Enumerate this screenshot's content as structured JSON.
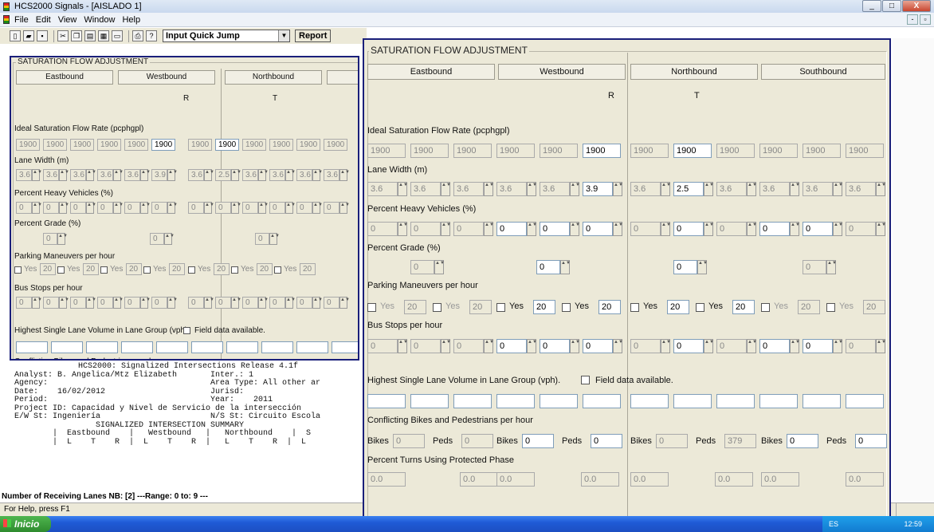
{
  "window": {
    "title": "HCS2000 Signals - [AISLADO 1]"
  },
  "menu": [
    "File",
    "Edit",
    "View",
    "Window",
    "Help"
  ],
  "toolbar": {
    "quick_jump": "Input Quick Jump",
    "report": "Report"
  },
  "saturation": {
    "title": "SATURATION FLOW ADJUSTMENT",
    "directions": [
      "Eastbound",
      "Westbound",
      "Northbound",
      "Southbound"
    ],
    "westbound_flag": "R",
    "northbound_flag": "T",
    "ideal_label": "Ideal Saturation Flow Rate (pcphgpl)",
    "ideal_values": [
      "1900",
      "1900",
      "1900",
      "1900",
      "1900",
      "1900",
      "1900",
      "1900",
      "1900",
      "1900",
      "1900",
      "1900"
    ],
    "lane_width_label": "Lane Width (m)",
    "lane_width_values": [
      "3.6",
      "3.6",
      "3.6",
      "3.6",
      "3.6",
      "3.9",
      "3.6",
      "2.5",
      "3.6",
      "3.6",
      "3.6",
      "3.6"
    ],
    "heavy_label": "Percent Heavy Vehicles (%)",
    "heavy_values": [
      "0",
      "0",
      "0",
      "0",
      "0",
      "0",
      "0",
      "0",
      "0",
      "0",
      "0",
      "0"
    ],
    "grade_label": "Percent Grade (%)",
    "grade_values": [
      "0",
      "0",
      "0",
      "0"
    ],
    "parking_label": "Parking Maneuvers per hour",
    "parking_yes": "Yes",
    "parking_values": [
      "20",
      "20",
      "20",
      "20",
      "20",
      "20",
      "20",
      "20"
    ],
    "bus_label": "Bus Stops per hour",
    "bus_values": [
      "0",
      "0",
      "0",
      "0",
      "0",
      "0",
      "0",
      "0",
      "0",
      "0",
      "0",
      "0"
    ],
    "highest_label": "Highest Single Lane Volume in Lane Group (vph).",
    "field_data_label": "Field data available.",
    "conflicting_label": "Conflicting Bikes and Pedestrians per hour",
    "bikes_label": "Bikes",
    "peds_label": "Peds",
    "conflict_values": [
      "0",
      "0",
      "0",
      "0",
      "0",
      "379",
      "0",
      "0"
    ],
    "turns_label": "Percent Turns Using Protected Phase",
    "turns_values": [
      "0.0",
      "0.0",
      "0.0",
      "0.0",
      "0.0",
      "0.0",
      "0.0",
      "0.0"
    ]
  },
  "report": {
    "header": "HCS2000: Signalized Intersections Release 4.1f",
    "lines": [
      "Analyst: B. Angelica/Mtz Elizabeth       Inter.: 1",
      "Agency:                                  Area Type: All other ar",
      "Date:    16/02/2012                      Jurisd:",
      "Period:                                  Year:    2011",
      "Project ID: Capacidad y Nivel de Servicio de la intersección",
      "E/W St: Ingeniería                       N/S St: Circuito Escola",
      "",
      "                 SIGNALIZED INTERSECTION SUMMARY",
      "        |  Eastbound    |   Westbound   |   Northbound    |  S",
      "        |  L    T    R  |  L    T    R  |   L    T    R  |  L"
    ]
  },
  "status": {
    "receiving": "Number of Receiving Lanes NB: [2]   ---Range: 0   to: 9  ---",
    "help": "For Help, press F1"
  },
  "taskbar": {
    "start": "Inicio",
    "lang": "ES",
    "time": "12:59"
  }
}
